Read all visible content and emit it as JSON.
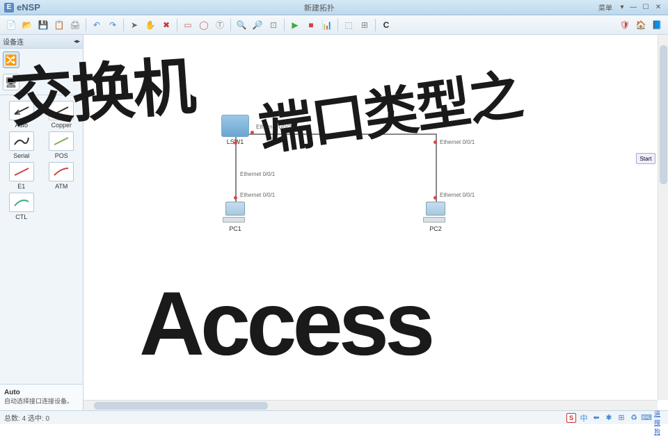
{
  "app": {
    "name": "eNSP",
    "window_title": "新建拓扑",
    "menu_label": "菜单"
  },
  "sidebar": {
    "tab_title": "设备连",
    "info": {
      "title": "Auto",
      "desc": "自动选择接口连接设备。"
    },
    "connections": [
      {
        "label": "Auto",
        "color": "#333"
      },
      {
        "label": "Copper",
        "color": "#333"
      },
      {
        "label": "Serial",
        "color": "#333"
      },
      {
        "label": "POS",
        "color": "#8a5"
      },
      {
        "label": "E1",
        "color": "#c44"
      },
      {
        "label": "ATM",
        "color": "#c44"
      },
      {
        "label": "CTL",
        "color": "#4a8"
      }
    ]
  },
  "topology": {
    "switch": {
      "name": "LSW1",
      "ports": [
        "Ethernet 0/0/1",
        "Ethernet 0/0/2"
      ]
    },
    "pc1": {
      "name": "PC1",
      "port": "Ethernet 0/0/1"
    },
    "pc2": {
      "name": "PC2",
      "port": "Ethernet 0/0/1"
    },
    "lsw2_port": "Ethernet 0/0/1",
    "start_label": "Start"
  },
  "status": {
    "total_label": "总数: 4 选中: 0"
  },
  "overlay": {
    "t1": "交换机",
    "t2": "端口类型之",
    "t3": "Access"
  },
  "tray_text": "中"
}
